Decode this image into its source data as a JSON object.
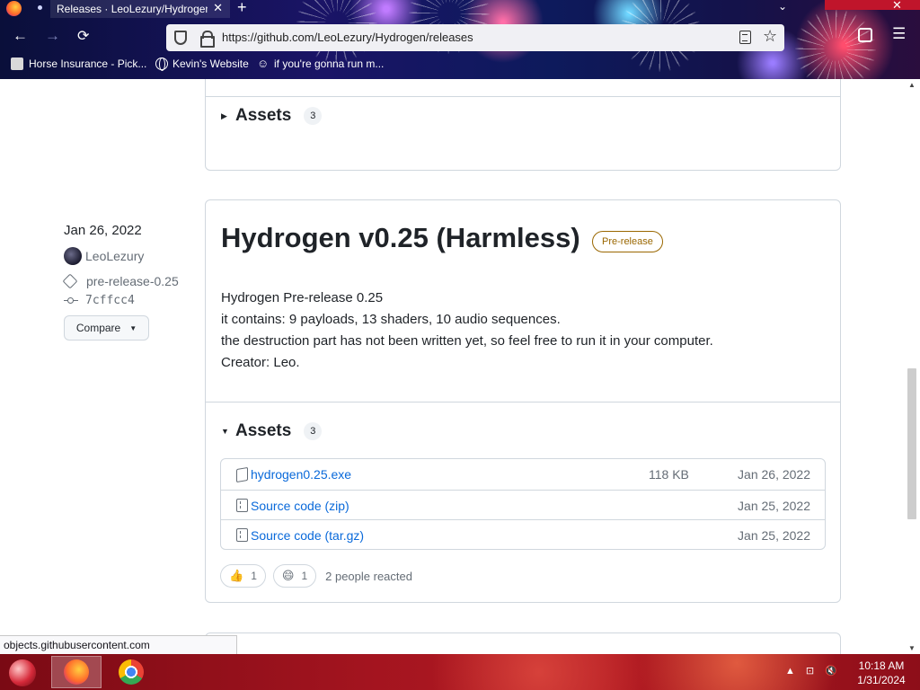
{
  "browser": {
    "tab_title": "Releases · LeoLezury/Hydrogen",
    "tab_close": "✕",
    "new_tab": "+",
    "window_chevron": "⌄",
    "window_close": "✕",
    "url": "https://github.com/LeoLezury/Hydrogen/releases",
    "nav_back": "←",
    "nav_forward": "→",
    "nav_reload_stop": "⟳",
    "star": "☆",
    "menu": "☰",
    "bookmarks": [
      {
        "label": "Horse Insurance - Pick...",
        "icon": "bookmark-favicon"
      },
      {
        "label": "Kevin's Website",
        "icon": "globe-icon"
      },
      {
        "label": "if you're gonna run m...",
        "icon": "face-icon"
      }
    ],
    "status_text": "objects.githubusercontent.com"
  },
  "prev_release": {
    "assets_label": "Assets",
    "assets_count": "3"
  },
  "release": {
    "date": "Jan 26, 2022",
    "author": "LeoLezury",
    "tag": "pre-release-0.25",
    "commit": "7cffcc4",
    "compare_label": "Compare",
    "title": "Hydrogen v0.25 (Harmless)",
    "badge": "Pre-release",
    "notes": [
      "Hydrogen Pre-release 0.25",
      "it contains: 9 payloads, 13 shaders, 10 audio sequences.",
      "the destruction part has not been written yet, so feel free to run it in your computer.",
      "Creator: Leo."
    ],
    "assets_label": "Assets",
    "assets_count": "3",
    "assets": [
      {
        "name": "hydrogen0.25.exe",
        "ext": "",
        "size": "118 KB",
        "date": "Jan 26, 2022",
        "icon": "package-icon"
      },
      {
        "name": "Source code",
        "ext": "(zip)",
        "size": "",
        "date": "Jan 25, 2022",
        "icon": "file-zip-icon"
      },
      {
        "name": "Source code",
        "ext": "(tar.gz)",
        "size": "",
        "date": "Jan 25, 2022",
        "icon": "file-zip-icon"
      }
    ],
    "reactions": [
      {
        "emoji": "👍",
        "count": "1"
      },
      {
        "emoji": "😄",
        "count": "1"
      }
    ],
    "reactions_text": "2 people reacted"
  },
  "taskbar": {
    "apps": [
      "Firefox",
      "Chrome"
    ],
    "time": "10:18 AM",
    "date": "1/31/2024",
    "tray_icons": [
      "chevron-up-icon",
      "network-icon",
      "volume-muted-icon"
    ],
    "tray_glyphs": [
      "▲",
      "⊡",
      "🔇"
    ]
  },
  "colors": {
    "link": "#0969da",
    "prerelease": "#9a6700",
    "muted": "#656d76",
    "border": "#d0d7de",
    "taskbar": "#a3141f"
  }
}
